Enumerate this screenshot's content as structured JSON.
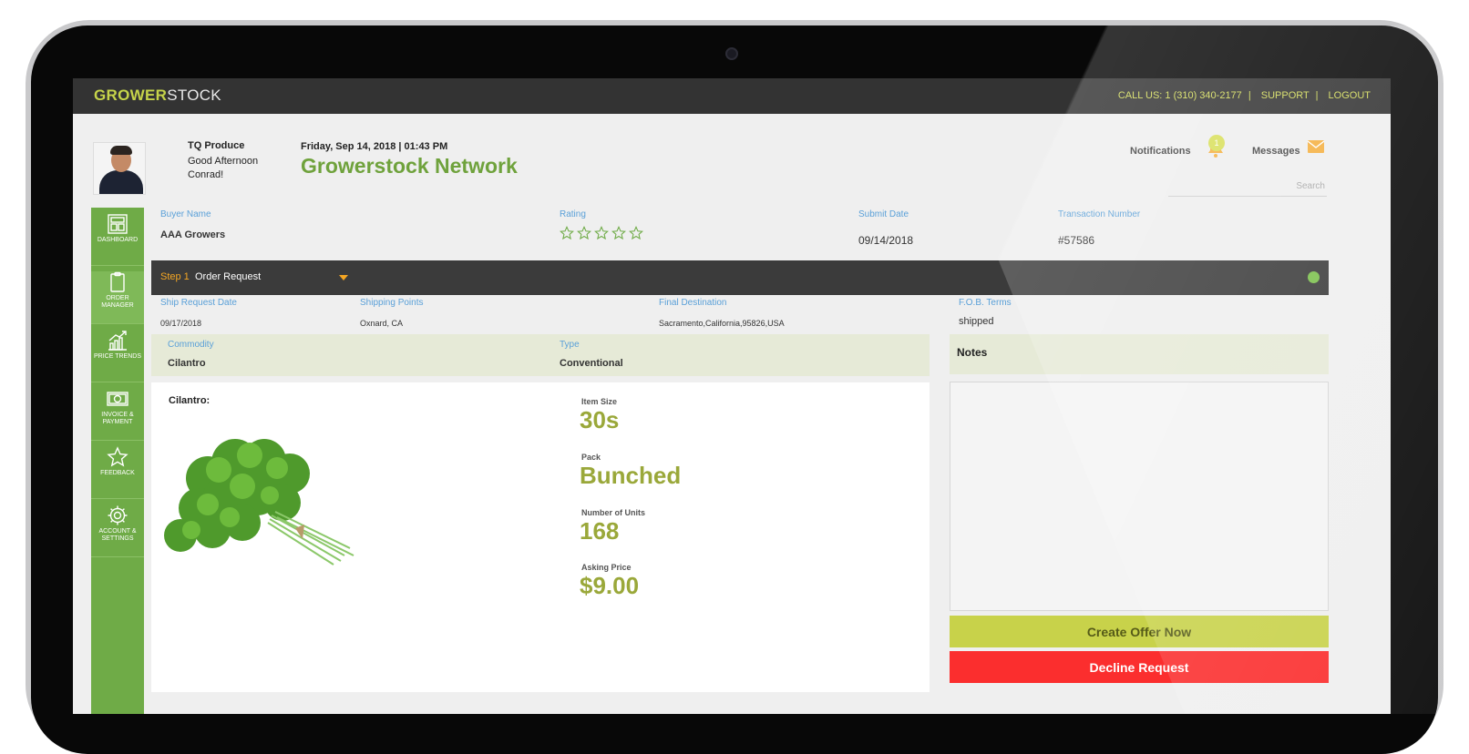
{
  "topbar": {
    "logo_grow": "GROWER",
    "logo_stock": "STOCK",
    "call": "CALL US: 1 (310) 340-2177",
    "support": "SUPPORT",
    "logout": "LOGOUT",
    "separator": "|"
  },
  "header": {
    "company": "TQ Produce",
    "greeting": "Good Afternoon Conrad!",
    "datetime": "Friday, Sep 14, 2018 | 01:43 PM",
    "network": "Growerstock Network",
    "notifications_label": "Notifications",
    "notifications_count": "1",
    "messages_label": "Messages",
    "search_placeholder": "Search"
  },
  "sidebar": {
    "items": [
      {
        "label": "DASHBOARD",
        "icon": "dashboard-icon"
      },
      {
        "label": "ORDER MANAGER",
        "icon": "clipboard-icon"
      },
      {
        "label": "PRICE TRENDS",
        "icon": "chart-icon"
      },
      {
        "label": "INVOICE & PAYMENT",
        "icon": "cash-icon"
      },
      {
        "label": "FEEDBACK",
        "icon": "star-icon"
      },
      {
        "label": "ACCOUNT & SETTINGS",
        "icon": "gear-icon"
      }
    ],
    "active": "ORDER MANAGER"
  },
  "summary": {
    "buyer_label": "Buyer Name",
    "buyer_value": "AAA Growers",
    "rating_label": "Rating",
    "rating_stars_filled": 0,
    "rating_stars_total": 5,
    "submit_label": "Submit Date",
    "submit_value": "09/14/2018",
    "txn_label": "Transaction Number",
    "txn_value": "#57586"
  },
  "step": {
    "number": "Step 1",
    "name": "Order Request",
    "status_color": "#7cc04d"
  },
  "shipping": {
    "ship_date_label": "Ship Request Date",
    "ship_date_value": "09/17/2018",
    "points_label": "Shipping Points",
    "points_value": "Oxnard, CA",
    "dest_label": "Final Destination",
    "dest_value": "Sacramento,California,95826,USA",
    "fob_label": "F.O.B. Terms",
    "fob_value": "shipped"
  },
  "commodity": {
    "commodity_label": "Commodity",
    "commodity_value": "Cilantro",
    "type_label": "Type",
    "type_value": "Conventional"
  },
  "product": {
    "title": "Cilantro:",
    "image": "cilantro-bunch",
    "size_label": "Item Size",
    "size_value": "30s",
    "pack_label": "Pack",
    "pack_value": "Bunched",
    "units_label": "Number of Units",
    "units_value": "168",
    "price_label": "Asking Price",
    "price_value": "$9.00"
  },
  "notes": {
    "title": "Notes"
  },
  "actions": {
    "offer": "Create Offer Now",
    "decline": "Decline Request"
  },
  "colors": {
    "brand_green": "#6fab47",
    "accent_lime": "#c8d24a",
    "decline_red": "#fb2e2e",
    "label_blue": "#5aa0d8",
    "step_orange": "#f5a623"
  }
}
